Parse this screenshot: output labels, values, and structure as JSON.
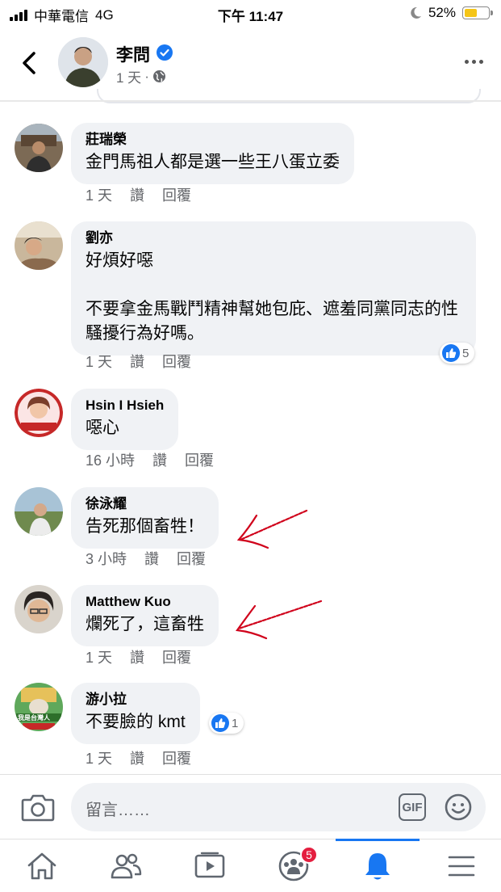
{
  "status_bar": {
    "carrier": "中華電信",
    "network": "4G",
    "time": "下午 11:47",
    "battery_percent": "52%",
    "battery_level": 0.52
  },
  "header": {
    "author_name": "李問",
    "post_age": "1 天",
    "separator": "·",
    "audience_icon": "globe-icon",
    "verified_icon": "verified-badge-icon",
    "more_icon": "more-horizontal-icon",
    "back_icon": "chevron-left-icon"
  },
  "comments": [
    {
      "name": "莊瑞榮",
      "text": "金門馬祖人都是選一些王八蛋立委",
      "time": "1 天",
      "like_action": "讚",
      "reply_action": "回覆"
    },
    {
      "name": "劉亦",
      "text": "好煩好噁\n\n不要拿金馬戰鬥精神幫她包庇、遮羞同黨同志的性騷擾行為好嗎。",
      "time": "1 天",
      "like_action": "讚",
      "reply_action": "回覆",
      "reaction_count": "5"
    },
    {
      "name": "Hsin I Hsieh",
      "text": "噁心",
      "time": "16 小時",
      "like_action": "讚",
      "reply_action": "回覆"
    },
    {
      "name": "徐泳耀",
      "text": "告死那個畜牲！",
      "time": "3 小時",
      "like_action": "讚",
      "reply_action": "回覆"
    },
    {
      "name": "Matthew Kuo",
      "text": "爛死了，這畜牲",
      "time": "1 天",
      "like_action": "讚",
      "reply_action": "回覆"
    },
    {
      "name": "游小拉",
      "text": "不要臉的 kmt",
      "time": "1 天",
      "like_action": "讚",
      "reply_action": "回覆",
      "reaction_count": "1",
      "avatar_caption": "我是台灣人"
    }
  ],
  "composer": {
    "placeholder": "留言……",
    "gif_label": "GIF",
    "camera_icon": "camera-icon",
    "emoji_icon": "emoji-icon"
  },
  "tabbar": {
    "tabs": [
      {
        "icon": "home-icon"
      },
      {
        "icon": "friends-icon"
      },
      {
        "icon": "watch-icon"
      },
      {
        "icon": "groups-icon",
        "badge": "5"
      },
      {
        "icon": "notifications-bell-icon",
        "active": true
      },
      {
        "icon": "menu-icon"
      }
    ]
  },
  "colors": {
    "accent": "#1877f2",
    "bubble": "#f0f2f5",
    "annotation_arrow": "#d0021b",
    "badge": "#e41e3f"
  }
}
